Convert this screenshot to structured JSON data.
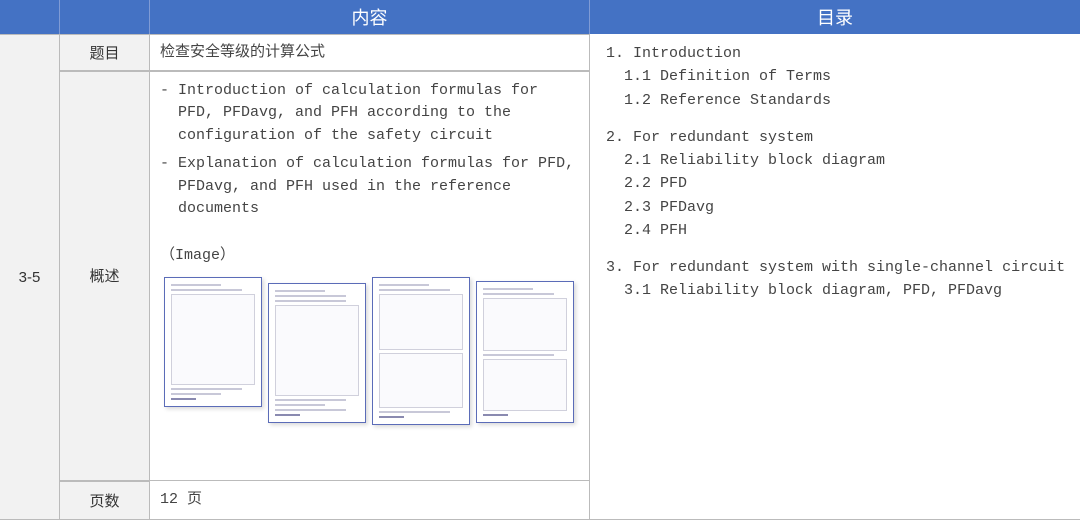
{
  "header": {
    "content_label": "内容",
    "toc_label": "目录"
  },
  "row_id": "3-5",
  "rows": {
    "title_label": "题目",
    "title_value": "检查安全等级的计算公式",
    "overview_label": "概述",
    "overview_bullet1": "- Introduction of calculation formulas for PFD, PFDavg, and PFH according to the configuration of the safety circuit",
    "overview_bullet2": "- Explanation of calculation formulas for PFD, PFDavg, and PFH used in the reference documents",
    "image_label": "（Image）",
    "pages_label": "页数",
    "pages_value": "12 页"
  },
  "toc": {
    "s1": {
      "h": "1.  Introduction",
      "i1": "1.1  Definition of Terms",
      "i2": "1.2  Reference Standards"
    },
    "s2": {
      "h": "2.  For redundant system",
      "i1": "2.1  Reliability block diagram",
      "i2": "2.2  PFD",
      "i3": "2.3  PFDavg",
      "i4": "2.4  PFH"
    },
    "s3": {
      "h": "3.  For redundant system with single-channel circuit",
      "i1": "3.1  Reliability block diagram, PFD, PFDavg"
    }
  }
}
